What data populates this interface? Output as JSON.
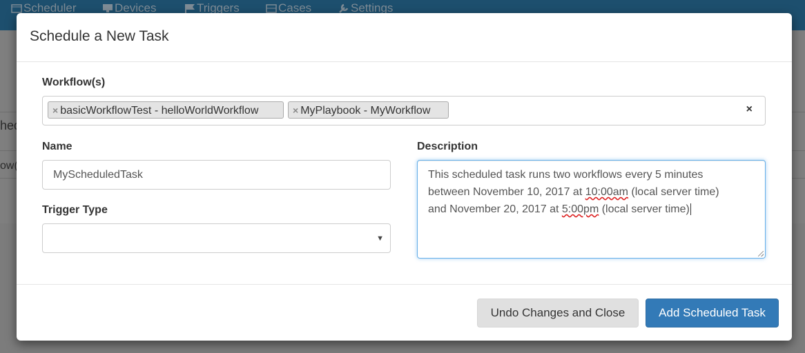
{
  "navbar": {
    "items": [
      {
        "label": "Scheduler",
        "icon": "calendar-icon"
      },
      {
        "label": "Devices",
        "icon": "monitor-icon"
      },
      {
        "label": "Triggers",
        "icon": "flag-icon"
      },
      {
        "label": "Cases",
        "icon": "case-icon"
      },
      {
        "label": "Settings",
        "icon": "wrench-icon"
      }
    ]
  },
  "background": {
    "partial_heading": "hed",
    "partial_row": "ow("
  },
  "modal": {
    "title": "Schedule a New Task",
    "workflows": {
      "label": "Workflow(s)",
      "tags": [
        "basicWorkflowTest - helloWorldWorkflow",
        "MyPlaybook - MyWorkflow"
      ],
      "tag_remove": "×",
      "clear": "×"
    },
    "name": {
      "label": "Name",
      "value": "MyScheduledTask"
    },
    "trigger_type": {
      "label": "Trigger Type",
      "value": ""
    },
    "description": {
      "label": "Description",
      "line1": "This scheduled task runs two workflows every 5 minutes",
      "line2_a": "between November 10, 2017 at ",
      "line2_b": "10:00am",
      "line2_c": " (local server time)",
      "line3_a": "and November 20, 2017 at ",
      "line3_b": "5:00pm",
      "line3_c": " (local server time)"
    },
    "footer": {
      "undo_label": "Undo Changes and Close",
      "add_label": "Add Scheduled Task"
    }
  },
  "colors": {
    "primary": "#337ab7",
    "navbar": "#1d4f6e",
    "focus": "#66afe9"
  }
}
